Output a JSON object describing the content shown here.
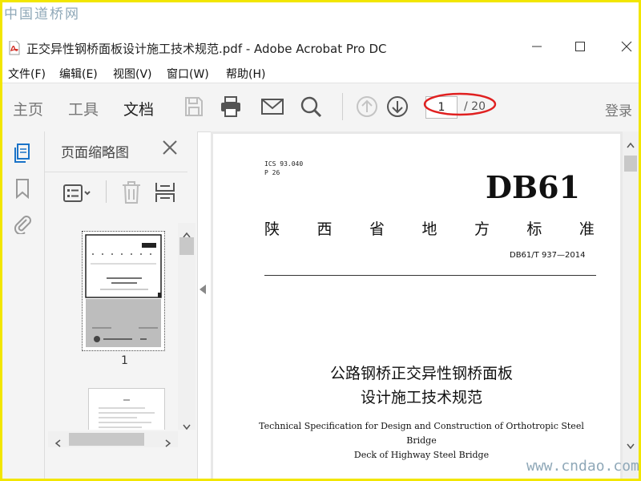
{
  "watermark": {
    "top": "中国道桥网",
    "bottom": "www.cndao.com"
  },
  "window": {
    "title": "正交异性钢桥面板设计施工技术规范.pdf - Adobe Acrobat Pro DC",
    "minimize_icon": "minimize-icon",
    "maximize_icon": "maximize-icon",
    "close_icon": "close-icon"
  },
  "menu": [
    "文件(F)",
    "编辑(E)",
    "视图(V)",
    "窗口(W)",
    "帮助(H)"
  ],
  "toolbar": {
    "tabs": [
      {
        "label": "主页",
        "active": false
      },
      {
        "label": "工具",
        "active": false
      },
      {
        "label": "文档",
        "active": true
      }
    ],
    "icons": [
      "save-icon",
      "print-icon",
      "email-icon",
      "search-icon",
      "page-up-icon",
      "page-down-icon"
    ],
    "page_current": "1",
    "page_total": "/ 20",
    "login": "登录",
    "highlight_color": "#e02020"
  },
  "thumbnail_panel": {
    "title": "页面缩略图",
    "page_label": "1"
  },
  "document": {
    "ics": "ICS 93.040",
    "p": "P 26",
    "db": "DB61",
    "standard_name": [
      "陕",
      "西",
      "省",
      "地",
      "方",
      "标",
      "准"
    ],
    "code": "DB61/T 937—2014",
    "title_cn_line1": "公路钢桥正交异性钢桥面板",
    "title_cn_line2": "设计施工技术规范",
    "title_en_line1": "Technical Specification for Design and Construction of Orthotropic Steel Bridge",
    "title_en_line2": "Deck of Highway Steel Bridge"
  },
  "colors": {
    "border": "#f2e600",
    "accent_blue": "#1a73c8"
  }
}
